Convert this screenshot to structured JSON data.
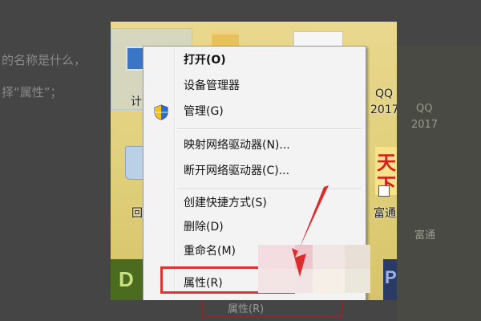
{
  "background": {
    "text_line_1": "的名称是什么，",
    "text_line_2": "择“属性”；",
    "right_labels": [
      "QQ",
      "2017",
      "富通"
    ],
    "bottom_menu_label": "属性(R)"
  },
  "desktop": {
    "computer_label": "计",
    "recycle_label": "回",
    "qq_label_1": "QQ",
    "qq_label_2": "2017",
    "fortune_label": "富通",
    "ad_chars": [
      "天",
      "下"
    ],
    "bottom_left_letter": "D",
    "bottom_right_letter": "P"
  },
  "context_menu": {
    "items": [
      {
        "label": "打开(O)",
        "bold": true
      },
      {
        "label": "设备管理器"
      },
      {
        "label": "管理(G)",
        "icon": "uac-shield-icon"
      },
      {
        "label": "映射网络驱动器(N)..."
      },
      {
        "label": "断开网络驱动器(C)..."
      },
      {
        "label": "创建快捷方式(S)"
      },
      {
        "label": "删除(D)"
      },
      {
        "label": "重命名(M)"
      },
      {
        "label": "属性(R)",
        "highlighted": true
      }
    ]
  },
  "colors": {
    "highlight": "#dd3333",
    "arrow": "#dd2a2a",
    "menu_bg": "#f3f3f3"
  }
}
